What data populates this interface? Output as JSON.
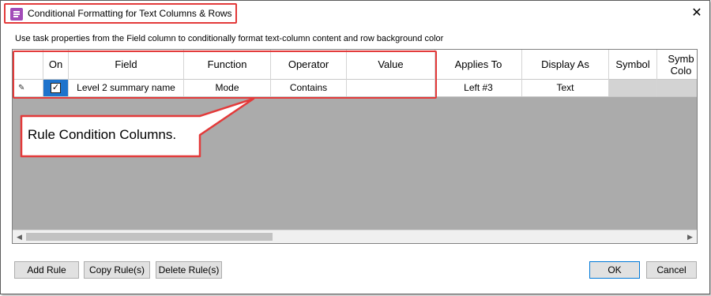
{
  "window": {
    "title": "Conditional Formatting for Text Columns & Rows",
    "close_glyph": "✕",
    "icon": "app-icon"
  },
  "description": "Use task properties from the Field column to conditionally format text-column content and row background color",
  "grid": {
    "headers": {
      "on": "On",
      "field": "Field",
      "function": "Function",
      "operator": "Operator",
      "value": "Value",
      "applies_to": "Applies To",
      "display_as": "Display As",
      "symbol": "Symbol",
      "symbol_color_line1": "Symb",
      "symbol_color_line2": "Colo"
    },
    "rows": [
      {
        "indicator": "✎",
        "on_checked": true,
        "check_glyph": "✓",
        "field": "Level 2 summary name",
        "function": "Mode",
        "operator": "Contains",
        "value": "",
        "applies_to": "Left #3",
        "display_as": "Text",
        "symbol": "",
        "symbol_color": ""
      }
    ],
    "scroll": {
      "left_arrow": "◀",
      "right_arrow": "▶"
    }
  },
  "callout": {
    "text": "Rule Condition Columns."
  },
  "buttons": {
    "add_rule": "Add Rule",
    "copy_rules": "Copy Rule(s)",
    "delete_rules": "Delete Rule(s)",
    "ok": "OK",
    "cancel": "Cancel"
  },
  "colors": {
    "highlight_red": "#e33a3a",
    "selected_cell_blue": "#1e73cc",
    "grid_background": "#ababab",
    "app_icon_purple": "#a24bb8"
  }
}
